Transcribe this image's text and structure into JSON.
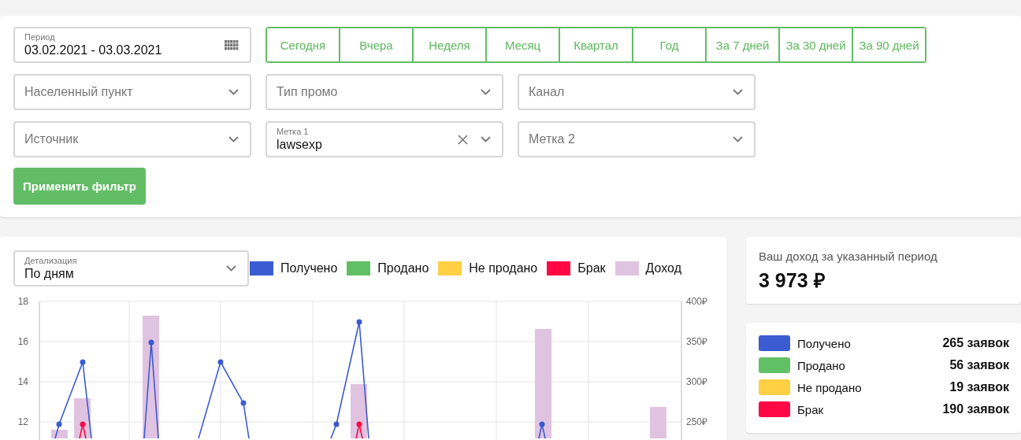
{
  "filters": {
    "period": {
      "label": "Период",
      "value": "03.02.2021 - 03.03.2021"
    },
    "quick_ranges": [
      {
        "label": "Сегодня",
        "selected": false
      },
      {
        "label": "Вчера",
        "selected": false
      },
      {
        "label": "Неделя",
        "selected": false
      },
      {
        "label": "Месяц",
        "selected": false
      },
      {
        "label": "Квартал",
        "selected": false
      },
      {
        "label": "Год",
        "selected": false
      },
      {
        "label": "За 7 дней",
        "selected": false
      },
      {
        "label": "За 30 дней",
        "selected": false
      },
      {
        "label": "За 90 дней",
        "selected": false
      }
    ],
    "selects": [
      {
        "placeholder": "Населенный пункт"
      },
      {
        "placeholder": "Тип промо"
      },
      {
        "placeholder": "Канал"
      },
      {
        "placeholder": "Источник"
      },
      {
        "label": "Метка 1",
        "value": "lawsexp",
        "clearable": true
      },
      {
        "placeholder": "Метка 2"
      }
    ],
    "apply_button": "Применить фильтр"
  },
  "chart_panel": {
    "detail": {
      "label": "Детализация",
      "value": "По дням"
    },
    "legend": [
      {
        "name": "Получено",
        "color": "#3a5bd1"
      },
      {
        "name": "Продано",
        "color": "#62c064"
      },
      {
        "name": "Не продано",
        "color": "#ffcf44"
      },
      {
        "name": "Брак",
        "color": "#ff0844"
      },
      {
        "name": "Доход",
        "color": "#e0c3e0"
      }
    ],
    "left_axis": [
      "18",
      "16",
      "14",
      "12"
    ],
    "right_axis": [
      "400₽",
      "350₽",
      "300₽",
      "250₽"
    ]
  },
  "income": {
    "label": "Ваш доход за указанный период",
    "value": "3 973 ₽"
  },
  "summary": [
    {
      "name": "Получено",
      "color": "#3a5bd1",
      "count": "265 заявок"
    },
    {
      "name": "Продано",
      "color": "#62c064",
      "count": "56 заявок"
    },
    {
      "name": "Не продано",
      "color": "#ffcf44",
      "count": "19 заявок"
    },
    {
      "name": "Брак",
      "color": "#ff0844",
      "count": "190 заявок"
    }
  ]
}
